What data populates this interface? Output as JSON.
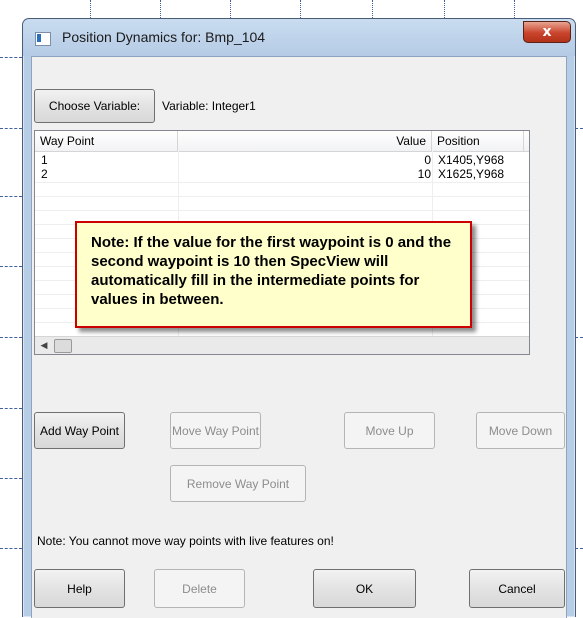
{
  "window": {
    "title": "Position Dynamics for: Bmp_104",
    "close_glyph": "x"
  },
  "variable": {
    "choose_button": "Choose Variable:",
    "label": "Variable: Integer1"
  },
  "waypoint_list": {
    "columns": [
      "Way Point",
      "Value",
      "Position"
    ],
    "rows": [
      {
        "way_point": "1",
        "value": "0",
        "position": "X1405,Y968"
      },
      {
        "way_point": "2",
        "value": "10",
        "position": "X1625,Y968"
      }
    ]
  },
  "callout": {
    "text": "Note: If the value for the first waypoint is 0 and the second waypoint is 10 then SpecView will automatically fill in the intermediate points for values in between."
  },
  "buttons": {
    "add_way_point": "Add Way Point",
    "move_way_point": "Move Way Point",
    "move_up": "Move Up",
    "move_down": "Move Down",
    "remove_way_point": "Remove Way Point",
    "help": "Help",
    "delete": "Delete",
    "ok": "OK",
    "cancel": "Cancel"
  },
  "note": "Note: You cannot move way points with live features on!",
  "colors": {
    "frame": "#b7cde6",
    "close_button": "#c9442c",
    "callout_border": "#cc0000",
    "callout_background": "#ffffcc"
  },
  "icons": {
    "app": "window-icon",
    "close": "close-icon",
    "scroll_left": "chevron-left-icon"
  }
}
